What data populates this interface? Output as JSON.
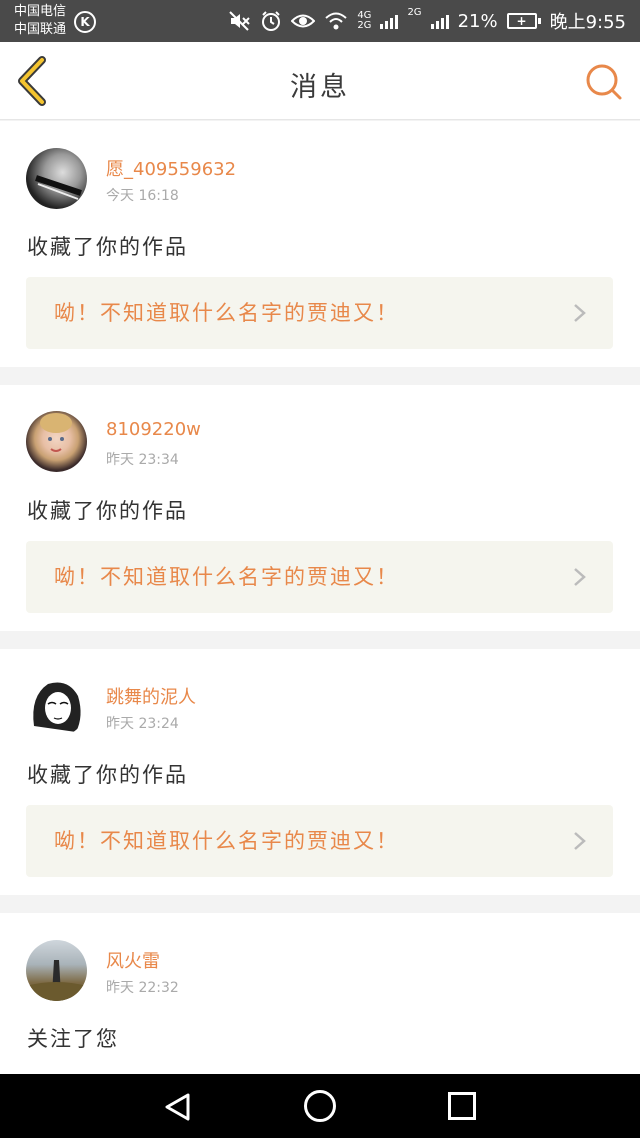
{
  "status_bar": {
    "carrier_1": "中国电信",
    "carrier_2": "中国联通",
    "k_badge": "K",
    "network_1": "4G",
    "network_2": "2G",
    "network_3": "2G",
    "battery_percent": "21%",
    "battery_symbol": "+",
    "time": "晚上9:55",
    "icons": [
      "mute-icon",
      "alarm-icon",
      "eye-icon",
      "wifi-icon",
      "signal-icon",
      "battery-icon"
    ]
  },
  "header": {
    "title": "消息",
    "back_icon": "chevron-left-icon",
    "search_icon": "search-icon",
    "accent_color": "#e8884a"
  },
  "messages": [
    {
      "username": "愿_409559632",
      "time": "今天 16:18",
      "action": "收藏了你的作品",
      "work_title": "呦！不知道取什么名字的贾迪又！",
      "avatar": "avatar-dark-photo"
    },
    {
      "username": "8109220w",
      "time": "昨天 23:34",
      "action": "收藏了你的作品",
      "work_title": "呦！不知道取什么名字的贾迪又！",
      "avatar": "avatar-blonde-girl"
    },
    {
      "username": "跳舞的泥人",
      "time": "昨天 23:24",
      "action": "收藏了你的作品",
      "work_title": "呦！不知道取什么名字的贾迪又！",
      "avatar": "avatar-sketch-girl"
    },
    {
      "username": "风火雷",
      "time": "昨天 22:32",
      "action": "关注了您",
      "avatar": "avatar-landscape"
    }
  ],
  "system_nav": {
    "back": "triangle-back-icon",
    "home": "circle-home-icon",
    "recents": "square-recents-icon"
  }
}
